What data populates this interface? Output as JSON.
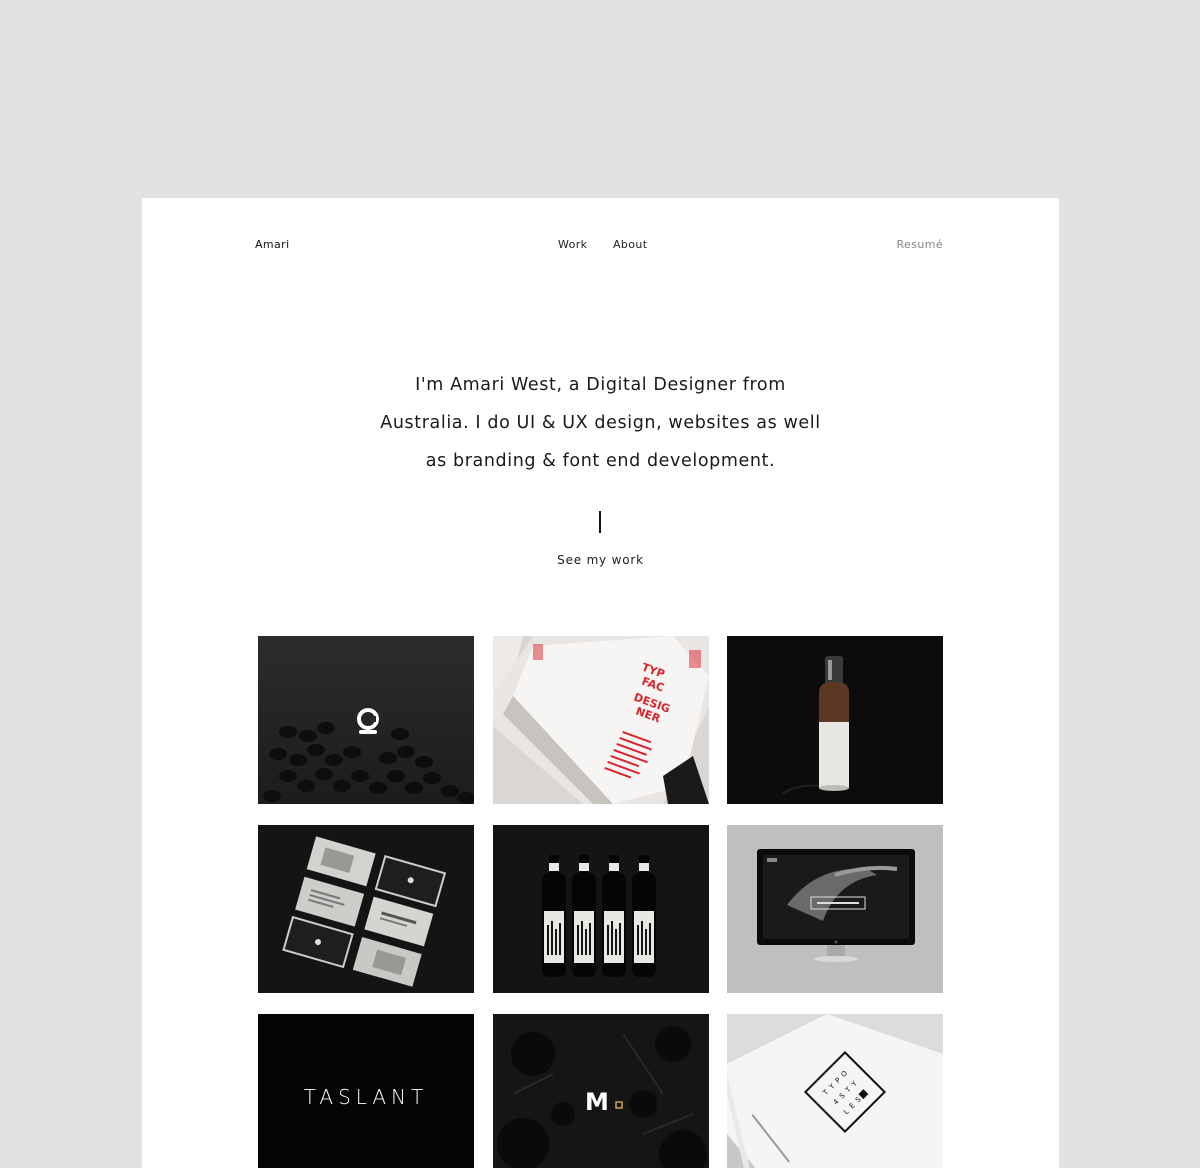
{
  "header": {
    "brand": "Amari",
    "nav": [
      {
        "label": "Work"
      },
      {
        "label": "About"
      }
    ],
    "resume_label": "Resumé"
  },
  "intro": {
    "lines": [
      "I'm Amari West, a Digital Designer from",
      "Australia. I do UI & UX design, websites as well",
      "as branding & font end development."
    ]
  },
  "cta": {
    "label": "See my work"
  },
  "portfolio": {
    "items": [
      {
        "name": "coffee-beans-logo-tile"
      },
      {
        "name": "red-type-book-tile",
        "text": [
          "TYP",
          "FAC",
          "DESIG",
          "NER"
        ]
      },
      {
        "name": "wood-bottle-lamp-tile"
      },
      {
        "name": "business-cards-tile"
      },
      {
        "name": "wine-bottles-tile"
      },
      {
        "name": "monitor-website-tile"
      },
      {
        "name": "taslant-logo-tile",
        "text": "TASLANT"
      },
      {
        "name": "m-logo-tile",
        "text": "M"
      },
      {
        "name": "typography-book-tile",
        "text": [
          "T Y P O",
          "4 S T Y",
          "L E S"
        ]
      }
    ]
  },
  "colors": {
    "page_bg": "#e2e2e2",
    "card_bg": "#ffffff",
    "text": "#1a1a1a",
    "muted": "#888888",
    "accent_red": "#d8242c"
  }
}
